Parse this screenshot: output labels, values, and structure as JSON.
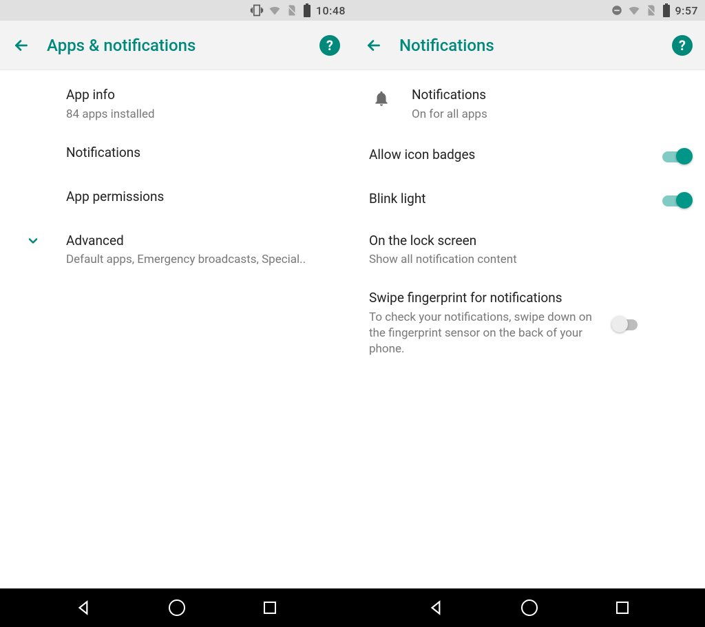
{
  "left": {
    "status": {
      "time": "10:48"
    },
    "appbar": {
      "title": "Apps & notifications"
    },
    "rows": {
      "app_info": {
        "title": "App info",
        "sub": "84 apps installed"
      },
      "notifications": {
        "title": "Notifications"
      },
      "permissions": {
        "title": "App permissions"
      },
      "advanced": {
        "title": "Advanced",
        "sub": "Default apps, Emergency broadcasts, Special.."
      }
    }
  },
  "right": {
    "status": {
      "time": "9:57"
    },
    "appbar": {
      "title": "Notifications"
    },
    "rows": {
      "notifications": {
        "title": "Notifications",
        "sub": "On for all apps"
      },
      "badges": {
        "title": "Allow icon badges",
        "toggle": true
      },
      "blink": {
        "title": "Blink light",
        "toggle": true
      },
      "lockscreen": {
        "title": "On the lock screen",
        "sub": "Show all notification content"
      },
      "fingerprint": {
        "title": "Swipe fingerprint for notifications",
        "sub": "To check your notifications, swipe down on the fingerprint sensor on the back of your phone.",
        "toggle": false
      }
    }
  }
}
